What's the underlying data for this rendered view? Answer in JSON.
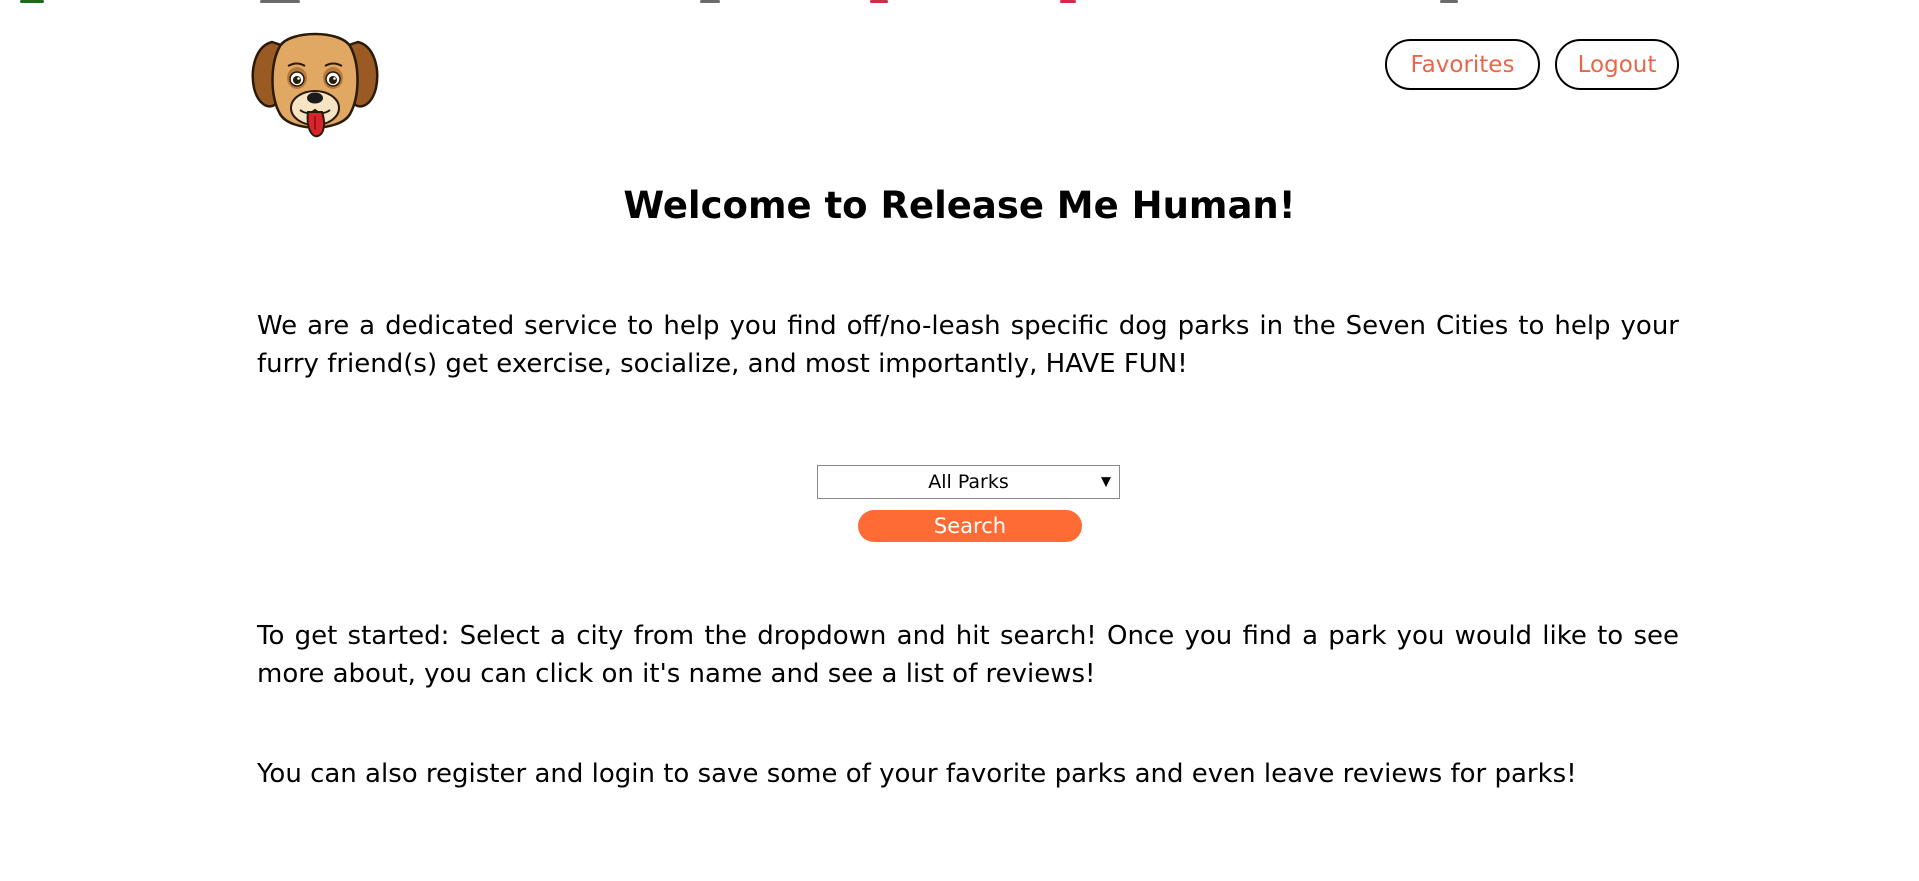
{
  "header": {
    "logo_alt": "dog-face-logo",
    "favorites_label": "Favorites",
    "logout_label": "Logout"
  },
  "main": {
    "title": "Welcome to Release Me Human!",
    "intro": "We are a dedicated service to help you find off/no-leash specific dog parks in the Seven Cities to help your furry friend(s) get exercise, socialize, and most importantly, HAVE FUN!",
    "search": {
      "selected_option": "All Parks",
      "button_label": "Search"
    },
    "instructions": "To get started: Select a city from the dropdown and hit search! Once you find a park you would like to see more about, you can click on it's name and see a list of reviews!",
    "register_note": "You can also register and login to save some of your favorite parks and even leave reviews for parks!"
  },
  "colors": {
    "accent": "#ff6b35",
    "nav_text": "#e8664a",
    "background": "#ffffff",
    "text": "#000000"
  }
}
